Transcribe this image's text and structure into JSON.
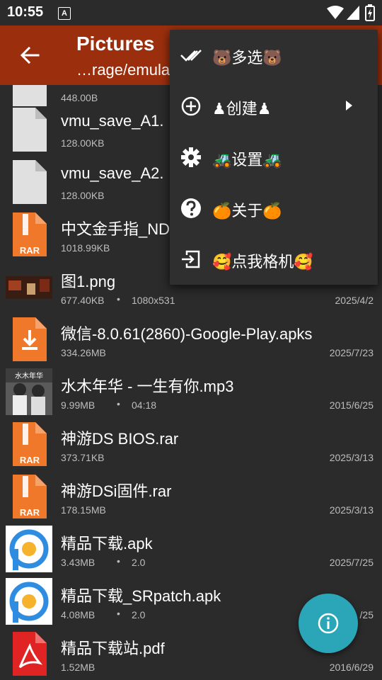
{
  "status": {
    "time": "10:55",
    "a_label": "A"
  },
  "app_bar": {
    "title": "Pictures",
    "subtitle": "…rage/emula"
  },
  "files": [
    {
      "name": "",
      "size": "448.00B",
      "extra": "",
      "date": "",
      "icon": "blank-file-icon"
    },
    {
      "name": "vmu_save_A1.",
      "size": "128.00KB",
      "extra": "",
      "date": "",
      "icon": "blank-file-icon"
    },
    {
      "name": "vmu_save_A2.",
      "size": "128.00KB",
      "extra": "",
      "date": "",
      "icon": "blank-file-icon"
    },
    {
      "name": "中文金手指_ND",
      "size": "1018.99KB",
      "extra": "",
      "date": "",
      "icon": "rar-file-icon"
    },
    {
      "name": "图1.png",
      "size": "677.40KB",
      "extra": "1080x531",
      "date": "2025/4/2",
      "icon": "image-thumbnail"
    },
    {
      "name": "微信-8.0.61(2860)-Google-Play.apks",
      "size": "334.26MB",
      "extra": "",
      "date": "2025/7/23",
      "icon": "download-file-icon"
    },
    {
      "name": "水木年华 - 一生有你.mp3",
      "size": "9.99MB",
      "extra": "04:18",
      "date": "2015/6/25",
      "icon": "album-art-thumbnail"
    },
    {
      "name": "神游DS BIOS.rar",
      "size": "373.71KB",
      "extra": "",
      "date": "2025/3/13",
      "icon": "rar-file-icon"
    },
    {
      "name": "神游DSi固件.rar",
      "size": "178.15MB",
      "extra": "",
      "date": "2025/3/13",
      "icon": "rar-file-icon"
    },
    {
      "name": "精品下载.apk",
      "size": "3.43MB",
      "extra": "2.0",
      "date": "2025/7/25",
      "icon": "app-icon"
    },
    {
      "name": "精品下载_SRpatch.apk",
      "size": "4.08MB",
      "extra": "2.0",
      "date": "/25",
      "icon": "app-icon"
    },
    {
      "name": "精品下载站.pdf",
      "size": "1.52MB",
      "extra": "",
      "date": "2016/6/29",
      "icon": "pdf-file-icon"
    }
  ],
  "menu": {
    "items": [
      {
        "label": "🐻多选🐻",
        "icon": "multi-select-icon"
      },
      {
        "label": "♟创建♟",
        "icon": "add-circle-icon"
      },
      {
        "label": "🚜设置🚜",
        "icon": "gear-icon"
      },
      {
        "label": "🍊关于🍊",
        "icon": "help-icon"
      },
      {
        "label": "🥰点我格机🥰",
        "icon": "exit-icon"
      }
    ]
  },
  "colors": {
    "app_bar": "#9b2f0d",
    "background": "#2b2b2b",
    "menu": "#2f2f2f",
    "fab": "#2aa6b8",
    "rar": "#f0782b"
  }
}
